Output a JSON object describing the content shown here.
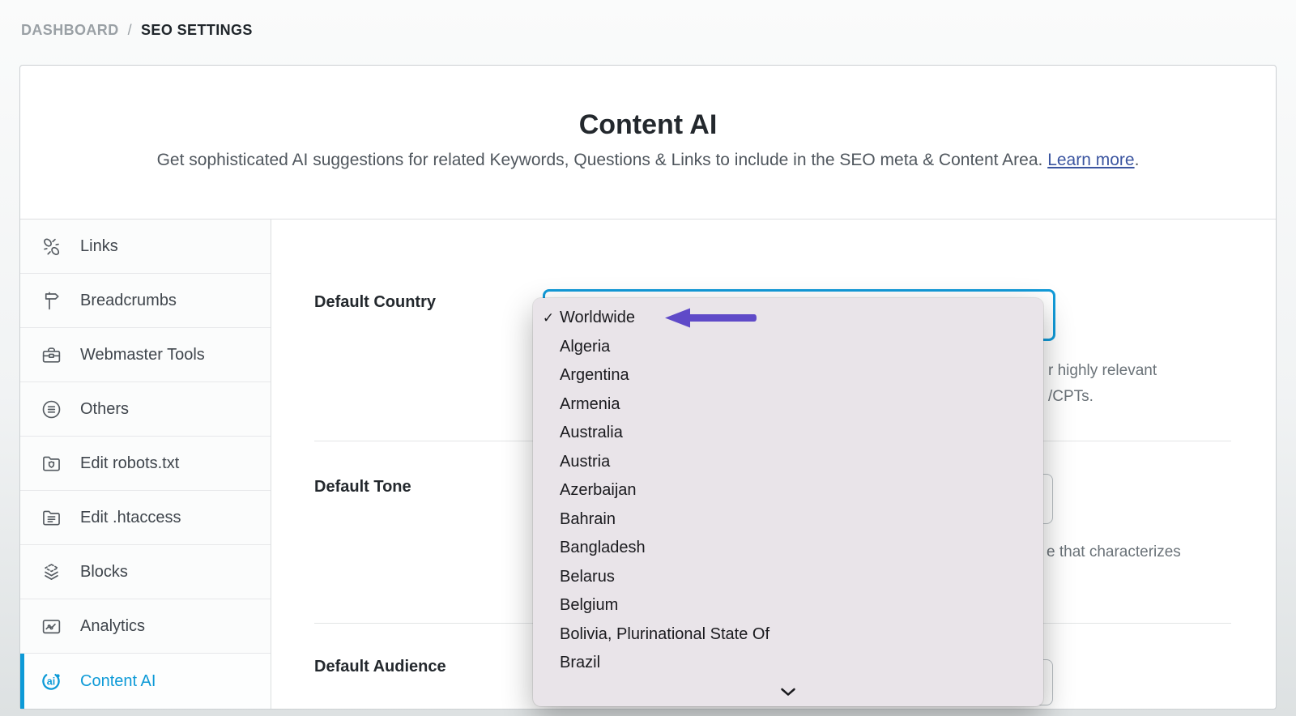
{
  "breadcrumb": {
    "dashboard": "DASHBOARD",
    "separator": "/",
    "current": "SEO SETTINGS"
  },
  "header": {
    "title": "Content AI",
    "subtitle": "Get sophisticated AI suggestions for related Keywords, Questions & Links to include in the SEO meta & Content Area.",
    "learn_more_label": "Learn more",
    "learn_more_suffix": "."
  },
  "sidebar": {
    "items": [
      {
        "label": "Links",
        "icon": "broken-link-icon",
        "active": false
      },
      {
        "label": "Breadcrumbs",
        "icon": "signpost-icon",
        "active": false
      },
      {
        "label": "Webmaster Tools",
        "icon": "toolbox-icon",
        "active": false
      },
      {
        "label": "Others",
        "icon": "circle-list-icon",
        "active": false
      },
      {
        "label": "Edit robots.txt",
        "icon": "folder-shield-icon",
        "active": false
      },
      {
        "label": "Edit .htaccess",
        "icon": "folder-lines-icon",
        "active": false
      },
      {
        "label": "Blocks",
        "icon": "layers-icon",
        "active": false
      },
      {
        "label": "Analytics",
        "icon": "chart-icon",
        "active": false
      },
      {
        "label": "Content AI",
        "icon": "content-ai-icon",
        "active": true
      }
    ]
  },
  "form": {
    "fields": [
      {
        "label": "Default Country",
        "desc_fragments": [
          "r highly relevant",
          "/CPTs."
        ]
      },
      {
        "label": "Default Tone",
        "desc_fragments": [
          "e that characterizes"
        ]
      },
      {
        "label": "Default Audience",
        "desc_fragments": []
      }
    ]
  },
  "dropdown": {
    "selected": "Worldwide",
    "checkmark": "✓",
    "more_indicator": "chevron-down-icon",
    "options": [
      "Worldwide",
      "Algeria",
      "Argentina",
      "Armenia",
      "Australia",
      "Austria",
      "Azerbaijan",
      "Bahrain",
      "Bangladesh",
      "Belarus",
      "Belgium",
      "Bolivia, Plurinational State Of",
      "Brazil"
    ]
  },
  "colors": {
    "accent_blue": "#129bd9",
    "active_sidebar_blue": "#0d9ad7",
    "annotation_arrow_purple": "#5f4ac8",
    "dropdown_bg": "#e9e4e9",
    "link_blue": "#3b55a0"
  }
}
